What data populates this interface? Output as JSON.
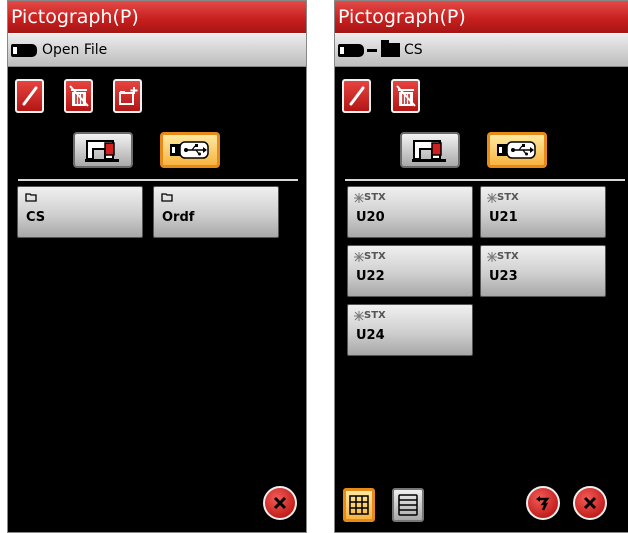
{
  "left": {
    "title": "Pictograph(P)",
    "path_label": "Open File",
    "tiles": [
      {
        "name": "CS",
        "kind": "folder"
      },
      {
        "name": "Ordf",
        "kind": "folder"
      }
    ]
  },
  "right": {
    "title": "Pictograph(P)",
    "path_label": "CS",
    "tiles": [
      {
        "tag": "STX",
        "name": "U20"
      },
      {
        "tag": "STX",
        "name": "U21"
      },
      {
        "tag": "STX",
        "name": "U22"
      },
      {
        "tag": "STX",
        "name": "U23"
      },
      {
        "tag": "STX",
        "name": "U24"
      }
    ]
  },
  "icons": [
    "pencil-icon",
    "trash-icon",
    "new-folder-icon",
    "sewing-machine-icon",
    "usb-icon",
    "grid-view-icon",
    "list-view-icon",
    "back-icon",
    "close-icon",
    "folder-icon",
    "stitch-icon"
  ],
  "colors": {
    "title_red": "#c8201f",
    "button_red": "#c3201d",
    "selected_orange": "#f7b441",
    "tile_gray": "#cfcfcf"
  }
}
